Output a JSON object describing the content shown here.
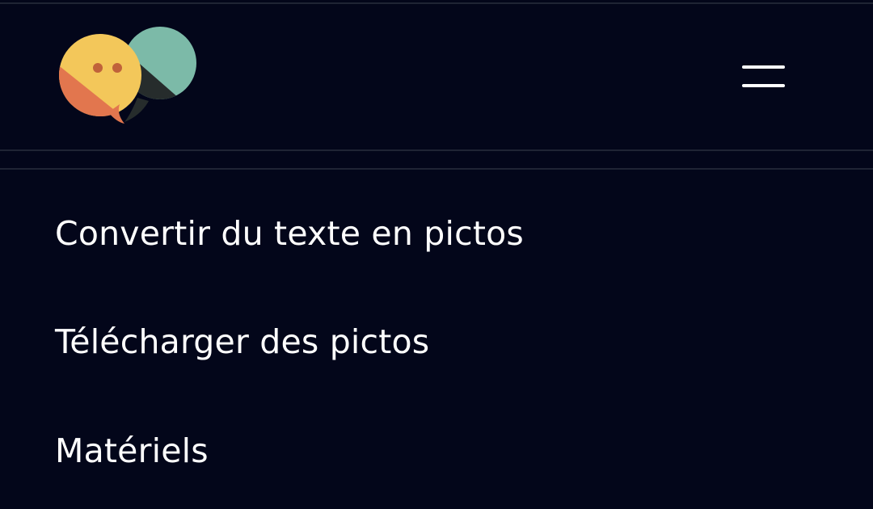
{
  "header": {
    "logo_icon": "speech-bubbles-logo-icon",
    "menu_icon": "hamburger-menu-icon"
  },
  "nav": {
    "items": [
      {
        "label": "Convertir du texte en pictos"
      },
      {
        "label": "Télécharger des pictos"
      },
      {
        "label": "Matériels"
      }
    ]
  },
  "colors": {
    "background": "#03061a",
    "divider": "#1f2434",
    "text": "#ffffff",
    "logo_yellow": "#f3c75a",
    "logo_orange": "#e2764e",
    "logo_teal": "#7cbaa8",
    "logo_dark": "#262c2c",
    "logo_dots": "#c0623a"
  }
}
